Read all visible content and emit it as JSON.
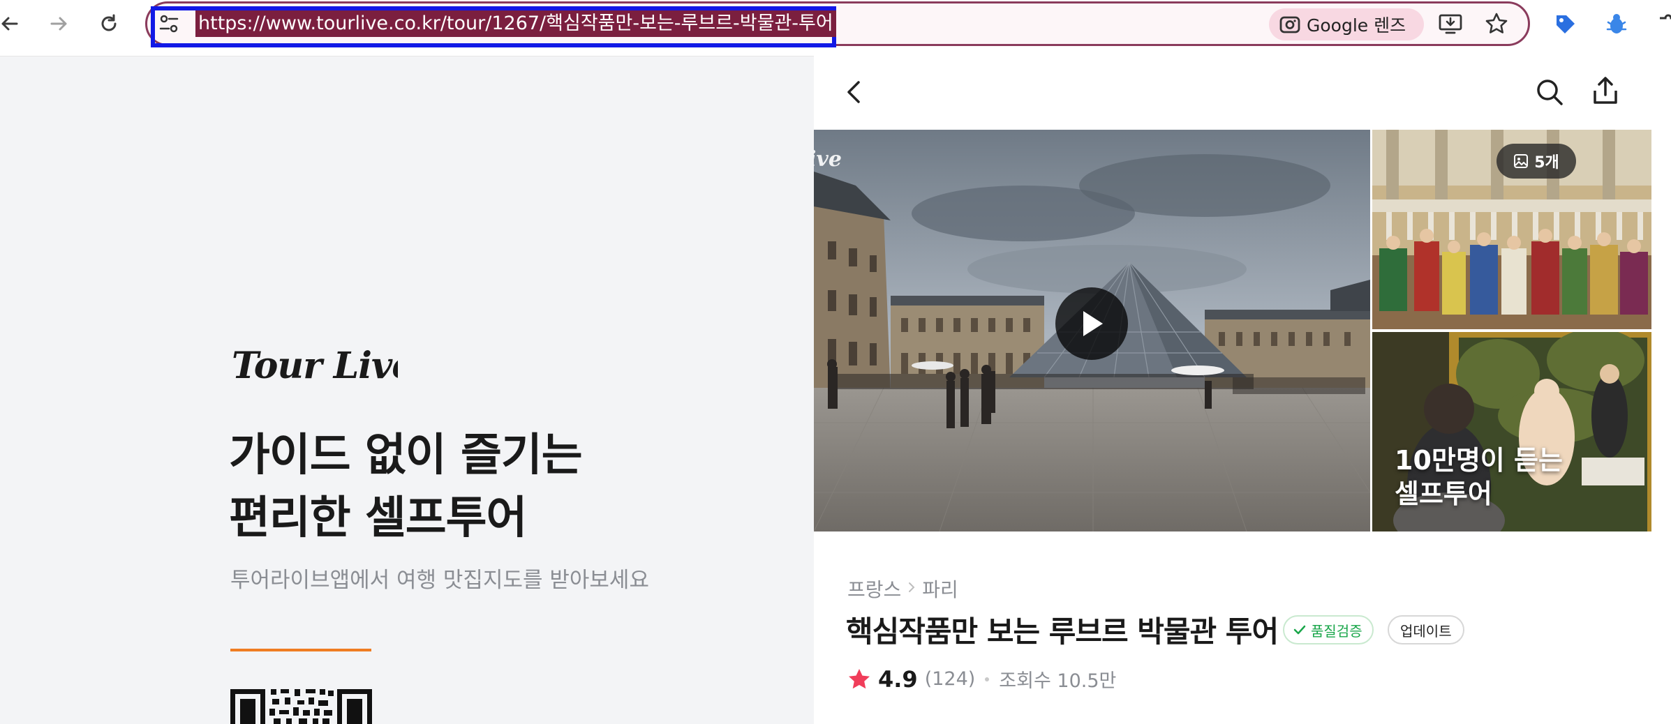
{
  "browser": {
    "url": "https://www.tourlive.co.kr/tour/1267/핵심작품만-보는-루브르-박물관-투어",
    "lens_label": "Google 렌즈",
    "icons": [
      "back-arrow-icon",
      "forward-arrow-icon",
      "reload-icon",
      "site-settings-icon",
      "google-lens-icon",
      "install-app-icon",
      "star-bookmark-icon",
      "extension-tag-icon",
      "extension-bug-icon",
      "extensions-puzzle-icon"
    ]
  },
  "promo": {
    "logo_text": "Tour Live",
    "headline_line1": "가이드 없이 즐기는",
    "headline_line2": "편리한 셀프투어",
    "subtext": "투어라이브앱에서 여행 맛집지도를 받아보세요",
    "accent_color": "#ef7d22"
  },
  "detail": {
    "photo_count": "5개",
    "photo_overlay_line1": "10만명이 듣는",
    "photo_overlay_line2": "셀프투어",
    "breadcrumb": [
      "프랑스",
      "파리"
    ],
    "title": "핵심작품만 보는 루브르 박물관 투어",
    "quality_badge": "품질검증",
    "update_badge": "업데이트",
    "rating": "4.9",
    "review_count": "(124)",
    "views": "조회수 10.5만",
    "star_color": "#f03d5a",
    "quality_color": "#19a64a"
  }
}
